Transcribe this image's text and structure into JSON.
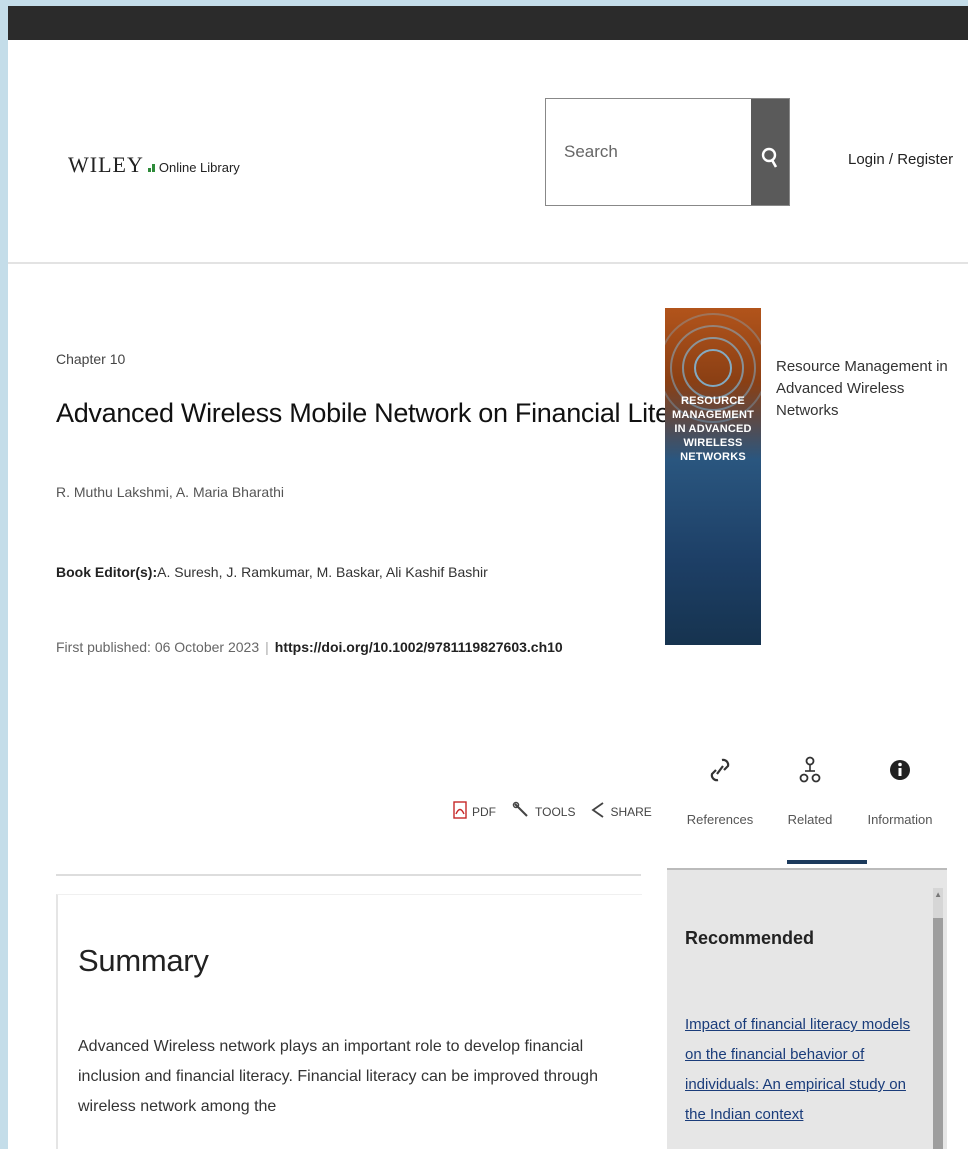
{
  "header": {
    "logo_brand": "WILEY",
    "logo_sub": "Online Library",
    "search_placeholder": "Search",
    "login_label": "Login / Register"
  },
  "chapter": {
    "label": "Chapter 10",
    "title": "Advanced Wireless Mobile Network on Financial Literacy",
    "authors": "R. Muthu Lakshmi, A. Maria Bharathi",
    "editors_label": "Book Editor(s):",
    "editors": "A. Suresh, J. Ramkumar, M. Baskar, Ali Kashif Bashir",
    "published_label": "First published: 06 October 2023",
    "doi": "https://doi.org/10.1002/9781119827603.ch10"
  },
  "book": {
    "title": "Resource Management in Advanced Wireless Networks",
    "cover_title": "RESOURCE MANAGEMENT IN ADVANCED WIRELESS NETWORKS"
  },
  "actions": {
    "pdf_label": "PDF",
    "tools_label": "TOOLS",
    "share_label": "SHARE"
  },
  "tabs": [
    {
      "label": "References",
      "icon": "link-icon"
    },
    {
      "label": "Related",
      "icon": "related-icon"
    },
    {
      "label": "Information",
      "icon": "info-icon"
    }
  ],
  "summary": {
    "heading": "Summary",
    "text": "Advanced Wireless network plays an important role to develop financial inclusion and financial literacy. Financial literacy can be improved through wireless network among the"
  },
  "sidebar": {
    "heading": "Recommended",
    "link": "Impact of financial literacy models on the financial behavior of individuals: An empirical study on the Indian context"
  },
  "colors": {
    "topbar": "#2b2b2b",
    "tab_active": "#1c3a5c",
    "link": "#1a3c7a",
    "logo_green": "#2e8b3a"
  }
}
